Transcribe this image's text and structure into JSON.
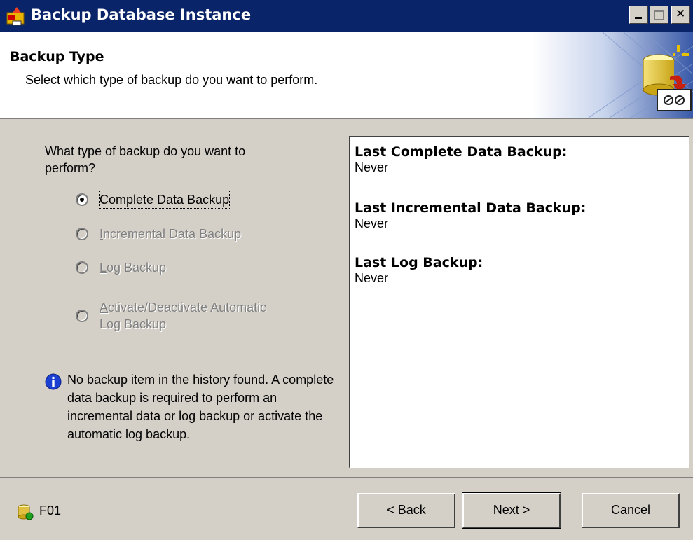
{
  "window": {
    "title": "Backup Database Instance"
  },
  "header": {
    "title": "Backup Type",
    "subtitle": "Select which type of backup do you want to perform."
  },
  "main": {
    "question": "What type of backup do you want to perform?",
    "options": [
      {
        "label": "Complete Data Backup",
        "mnemonic": "C",
        "rest": "omplete Data Backup",
        "selected": true,
        "enabled": true
      },
      {
        "label": "Incremental  Data Backup",
        "mnemonic": "I",
        "rest": "ncremental  Data Backup",
        "selected": false,
        "enabled": false
      },
      {
        "label": "Log Backup",
        "mnemonic": "L",
        "rest": "og Backup",
        "selected": false,
        "enabled": false
      },
      {
        "label": "Activate/Deactivate Automatic Log Backup",
        "mnemonic": "A",
        "rest": "ctivate/Deactivate Automatic",
        "line2": "Log Backup",
        "selected": false,
        "enabled": false
      }
    ],
    "info": "No backup item in the history found. A complete data backup is required to perform an incremental data or log backup or activate the automatic log backup."
  },
  "history": [
    {
      "label": "Last Complete Data Backup:",
      "value": "Never"
    },
    {
      "label": "Last Incremental Data Backup:",
      "value": "Never"
    },
    {
      "label": "Last Log Backup:",
      "value": "Never"
    }
  ],
  "footer": {
    "instance": "F01",
    "back": {
      "prefix": "< ",
      "mnemonic": "B",
      "rest": "ack"
    },
    "next": {
      "mnemonic": "N",
      "rest": "ext >"
    },
    "cancel": "Cancel"
  },
  "colors": {
    "titlebar": "#0a246a",
    "dialog": "#d4d0c8",
    "info_icon": "#1a3fd1"
  },
  "icons": [
    "app-icon",
    "minimize-icon",
    "maximize-icon",
    "close-icon",
    "database-backup-icon",
    "info-icon",
    "database-status-icon"
  ]
}
